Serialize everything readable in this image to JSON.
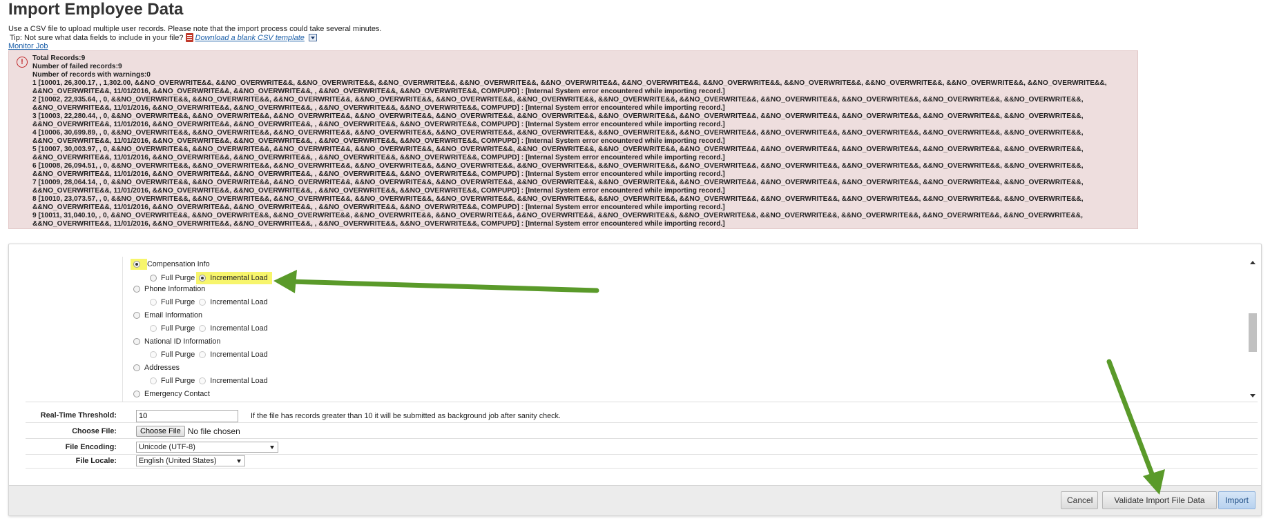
{
  "page": {
    "title": "Import Employee Data",
    "intro": "Use a CSV file to upload multiple user records. Please note that the import process could take several minutes.",
    "tip_prefix": "Tip: Not sure what data fields to include in your file?",
    "tip_link": "Download a blank CSV template",
    "monitor_link": "Monitor Job"
  },
  "errors": {
    "total": "Total Records:9",
    "failed": "Number of failed records:9",
    "warnings": "Number of records with warnings:0",
    "lines": [
      "1 [10001, 26,300.17, , 1,302.00, &&NO_OVERWRITE&&, &&NO_OVERWRITE&&, &&NO_OVERWRITE&&, &&NO_OVERWRITE&&, &&NO_OVERWRITE&&, &&NO_OVERWRITE&&, &&NO_OVERWRITE&&, &&NO_OVERWRITE&&, &&NO_OVERWRITE&&, &&NO_OVERWRITE&&, &&NO_OVERWRITE&&, &&NO_OVERWRITE&&,",
      "&&NO_OVERWRITE&&, 11/01/2016, &&NO_OVERWRITE&&, &&NO_OVERWRITE&&, , &&NO_OVERWRITE&&, &&NO_OVERWRITE&&, COMPUPD] : [Internal System error encountered while importing record.]",
      "2 [10002, 22,935.64, , 0, &&NO_OVERWRITE&&, &&NO_OVERWRITE&&, &&NO_OVERWRITE&&, &&NO_OVERWRITE&&, &&NO_OVERWRITE&&, &&NO_OVERWRITE&&, &&NO_OVERWRITE&&, &&NO_OVERWRITE&&, &&NO_OVERWRITE&&, &&NO_OVERWRITE&&, &&NO_OVERWRITE&&, &&NO_OVERWRITE&&,",
      "&&NO_OVERWRITE&&, 11/01/2016, &&NO_OVERWRITE&&, &&NO_OVERWRITE&&, , &&NO_OVERWRITE&&, &&NO_OVERWRITE&&, COMPUPD] : [Internal System error encountered while importing record.]",
      "3 [10003, 22,280.44, , 0, &&NO_OVERWRITE&&, &&NO_OVERWRITE&&, &&NO_OVERWRITE&&, &&NO_OVERWRITE&&, &&NO_OVERWRITE&&, &&NO_OVERWRITE&&, &&NO_OVERWRITE&&, &&NO_OVERWRITE&&, &&NO_OVERWRITE&&, &&NO_OVERWRITE&&, &&NO_OVERWRITE&&, &&NO_OVERWRITE&&,",
      "&&NO_OVERWRITE&&, 11/01/2016, &&NO_OVERWRITE&&, &&NO_OVERWRITE&&, , &&NO_OVERWRITE&&, &&NO_OVERWRITE&&, COMPUPD] : [Internal System error encountered while importing record.]",
      "4 [10006, 30,699.89, , 0, &&NO_OVERWRITE&&, &&NO_OVERWRITE&&, &&NO_OVERWRITE&&, &&NO_OVERWRITE&&, &&NO_OVERWRITE&&, &&NO_OVERWRITE&&, &&NO_OVERWRITE&&, &&NO_OVERWRITE&&, &&NO_OVERWRITE&&, &&NO_OVERWRITE&&, &&NO_OVERWRITE&&, &&NO_OVERWRITE&&,",
      "&&NO_OVERWRITE&&, 11/01/2016, &&NO_OVERWRITE&&, &&NO_OVERWRITE&&, , &&NO_OVERWRITE&&, &&NO_OVERWRITE&&, COMPUPD] : [Internal System error encountered while importing record.]",
      "5 [10007, 30,003.97, , 0, &&NO_OVERWRITE&&, &&NO_OVERWRITE&&, &&NO_OVERWRITE&&, &&NO_OVERWRITE&&, &&NO_OVERWRITE&&, &&NO_OVERWRITE&&, &&NO_OVERWRITE&&, &&NO_OVERWRITE&&, &&NO_OVERWRITE&&, &&NO_OVERWRITE&&, &&NO_OVERWRITE&&, &&NO_OVERWRITE&&,",
      "&&NO_OVERWRITE&&, 11/01/2016, &&NO_OVERWRITE&&, &&NO_OVERWRITE&&, , &&NO_OVERWRITE&&, &&NO_OVERWRITE&&, COMPUPD] : [Internal System error encountered while importing record.]",
      "6 [10008, 26,094.51, , 0, &&NO_OVERWRITE&&, &&NO_OVERWRITE&&, &&NO_OVERWRITE&&, &&NO_OVERWRITE&&, &&NO_OVERWRITE&&, &&NO_OVERWRITE&&, &&NO_OVERWRITE&&, &&NO_OVERWRITE&&, &&NO_OVERWRITE&&, &&NO_OVERWRITE&&, &&NO_OVERWRITE&&, &&NO_OVERWRITE&&,",
      "&&NO_OVERWRITE&&, 11/01/2016, &&NO_OVERWRITE&&, &&NO_OVERWRITE&&, , &&NO_OVERWRITE&&, &&NO_OVERWRITE&&, COMPUPD] : [Internal System error encountered while importing record.]",
      "7 [10009, 28,064.14, , 0, &&NO_OVERWRITE&&, &&NO_OVERWRITE&&, &&NO_OVERWRITE&&, &&NO_OVERWRITE&&, &&NO_OVERWRITE&&, &&NO_OVERWRITE&&, &&NO_OVERWRITE&&, &&NO_OVERWRITE&&, &&NO_OVERWRITE&&, &&NO_OVERWRITE&&, &&NO_OVERWRITE&&, &&NO_OVERWRITE&&,",
      "&&NO_OVERWRITE&&, 11/01/2016, &&NO_OVERWRITE&&, &&NO_OVERWRITE&&, , &&NO_OVERWRITE&&, &&NO_OVERWRITE&&, COMPUPD] : [Internal System error encountered while importing record.]",
      "8 [10010, 23,073.57, , 0, &&NO_OVERWRITE&&, &&NO_OVERWRITE&&, &&NO_OVERWRITE&&, &&NO_OVERWRITE&&, &&NO_OVERWRITE&&, &&NO_OVERWRITE&&, &&NO_OVERWRITE&&, &&NO_OVERWRITE&&, &&NO_OVERWRITE&&, &&NO_OVERWRITE&&, &&NO_OVERWRITE&&, &&NO_OVERWRITE&&,",
      "&&NO_OVERWRITE&&, 11/01/2016, &&NO_OVERWRITE&&, &&NO_OVERWRITE&&, , &&NO_OVERWRITE&&, &&NO_OVERWRITE&&, COMPUPD] : [Internal System error encountered while importing record.]",
      "9 [10011, 31,040.10, , 0, &&NO_OVERWRITE&&, &&NO_OVERWRITE&&, &&NO_OVERWRITE&&, &&NO_OVERWRITE&&, &&NO_OVERWRITE&&, &&NO_OVERWRITE&&, &&NO_OVERWRITE&&, &&NO_OVERWRITE&&, &&NO_OVERWRITE&&, &&NO_OVERWRITE&&, &&NO_OVERWRITE&&, &&NO_OVERWRITE&&,",
      "&&NO_OVERWRITE&&, 11/01/2016, &&NO_OVERWRITE&&, &&NO_OVERWRITE&&, , &&NO_OVERWRITE&&, &&NO_OVERWRITE&&, COMPUPD] : [Internal System error encountered while importing record.]"
    ]
  },
  "options": {
    "sections": [
      {
        "label": "Compensation Info",
        "selected": true,
        "full_purge": "Full Purge",
        "incremental": "Incremental Load",
        "mode": "incremental"
      },
      {
        "label": "Phone Information",
        "selected": false,
        "full_purge": "Full Purge",
        "incremental": "Incremental Load",
        "mode": "none"
      },
      {
        "label": "Email Information",
        "selected": false,
        "full_purge": "Full Purge",
        "incremental": "Incremental Load",
        "mode": "none"
      },
      {
        "label": "National ID Information",
        "selected": false,
        "full_purge": "Full Purge",
        "incremental": "Incremental Load",
        "mode": "none"
      },
      {
        "label": "Addresses",
        "selected": false,
        "full_purge": "Full Purge",
        "incremental": "Incremental Load",
        "mode": "none"
      },
      {
        "label": "Emergency Contact",
        "selected": false
      }
    ]
  },
  "form": {
    "threshold_label": "Real-Time Threshold:",
    "threshold_value": "10",
    "threshold_hint": "If the file has records greater than 10 it will be submitted as background job after sanity check.",
    "file_label": "Choose File:",
    "choose_button": "Choose File",
    "no_file": "No file chosen",
    "encoding_label": "File Encoding:",
    "encoding_value": "Unicode (UTF-8)",
    "locale_label": "File Locale:",
    "locale_value": "English (United States)"
  },
  "footer": {
    "cancel": "Cancel",
    "validate": "Validate Import File Data",
    "import": "Import"
  },
  "colors": {
    "highlight": "#f7f56c",
    "arrow": "#5a9a2a",
    "error_bg": "#eedede"
  }
}
